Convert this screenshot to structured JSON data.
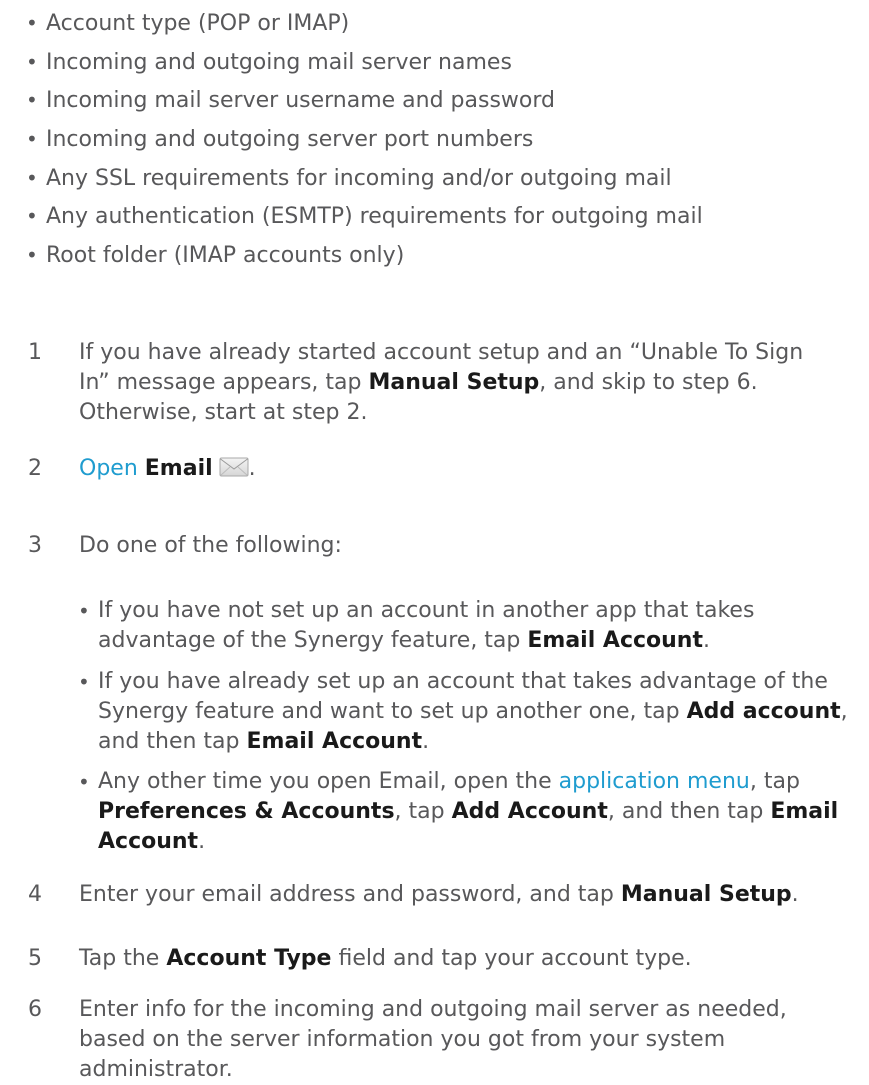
{
  "requirements": [
    "Account type (POP or IMAP)",
    "Incoming and outgoing mail server names",
    "Incoming mail server username and password",
    "Incoming and outgoing server port numbers",
    "Any SSL requirements for incoming and/or outgoing mail",
    "Any authentication (ESMTP) requirements for outgoing mail",
    "Root folder (IMAP accounts only)"
  ],
  "bullet": "•",
  "steps": {
    "s1": {
      "num": "1",
      "l1": "If you have already started account setup and an “Unable To Sign",
      "l2a": "In” message appears, tap ",
      "l2b": "Manual Setup",
      "l2c": ", and skip to step 6.",
      "l3": "Otherwise, start at step 2."
    },
    "s2": {
      "num": "2",
      "link": "Open",
      "bold": "Email",
      "icon": "email-envelope-icon",
      "end": "."
    },
    "s3": {
      "num": "3",
      "text": "Do one of the following:",
      "subs": {
        "a": {
          "l1": "If you have not set up an account in another app that takes",
          "l2a": "advantage of the Synergy feature, tap ",
          "l2b": "Email Account",
          "l2c": "."
        },
        "b": {
          "l1": "If you have already set up an account that takes advantage of the",
          "l2a": "Synergy feature and want to set up another one, tap ",
          "l2b": "Add account",
          "l2c": ",",
          "l3a": "and then tap ",
          "l3b": "Email Account",
          "l3c": "."
        },
        "c": {
          "l1a": "Any other time you open Email, open the ",
          "l1b": "application menu",
          "l1c": ", tap",
          "l2a": "Preferences & Accounts",
          "l2b": ", tap ",
          "l2c": "Add Account",
          "l2d": ", and then tap ",
          "l2e": "Email",
          "l3a": "Account",
          "l3b": "."
        }
      }
    },
    "s4": {
      "num": "4",
      "a": "Enter your email address and password, and tap ",
      "b": "Manual Setup",
      "c": "."
    },
    "s5": {
      "num": "5",
      "a": "Tap the ",
      "b": "Account Type",
      "c": " field and tap your account type."
    },
    "s6": {
      "num": "6",
      "l1": "Enter info for the incoming and outgoing mail server as needed,",
      "l2": "based on the server information you got from your system",
      "l3": "administrator."
    }
  }
}
